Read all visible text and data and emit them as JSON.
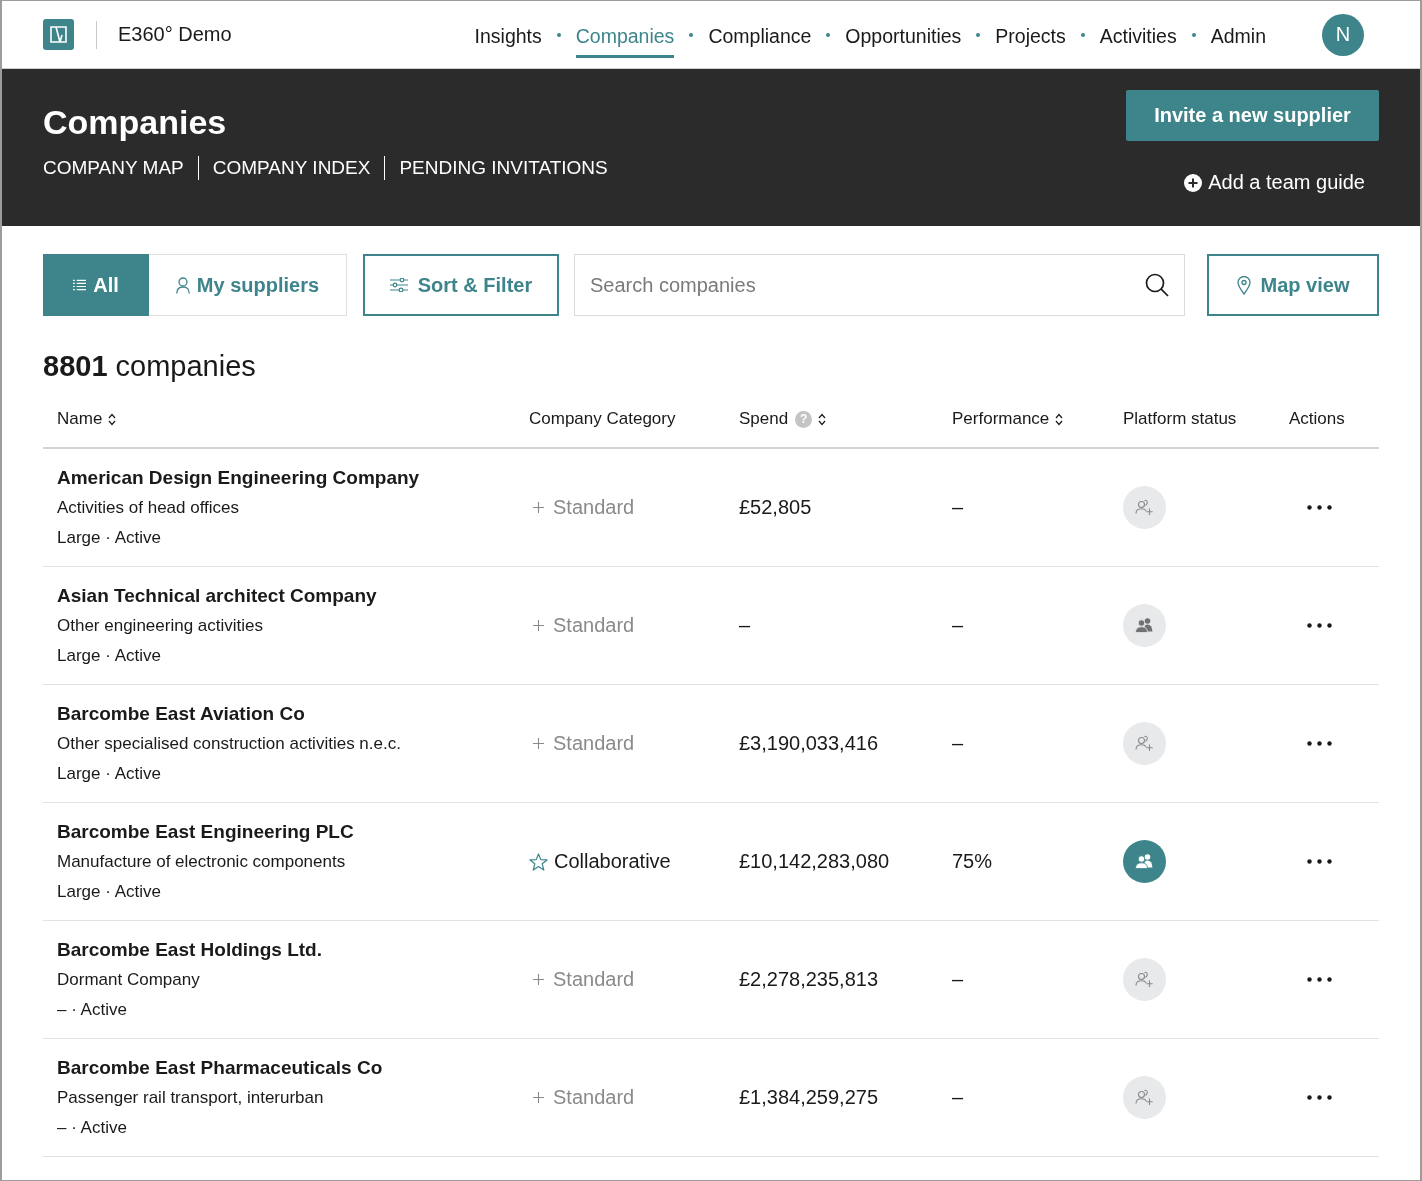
{
  "nav": {
    "app_name": "E360° Demo",
    "links": [
      {
        "label": "Insights",
        "selected": false
      },
      {
        "label": "Companies",
        "selected": true
      },
      {
        "label": "Compliance",
        "selected": false
      },
      {
        "label": "Opportunities",
        "selected": false
      },
      {
        "label": "Projects",
        "selected": false
      },
      {
        "label": "Activities",
        "selected": false
      },
      {
        "label": "Admin",
        "selected": false
      }
    ],
    "avatar_initial": "N"
  },
  "header": {
    "title": "Companies",
    "subnav": [
      "COMPANY MAP",
      "COMPANY INDEX",
      "PENDING INVITATIONS"
    ],
    "invite_button": "Invite a new supplier",
    "team_guide_link": "Add a team guide"
  },
  "toolbar": {
    "views": [
      {
        "label": "All",
        "kind": "list",
        "selected": true
      },
      {
        "label": "My suppliers",
        "kind": "person",
        "selected": false
      }
    ],
    "sort_filter_button": "Sort & Filter",
    "search": {
      "placeholder": "Search companies"
    },
    "map_view_button": "Map view"
  },
  "summary": "**8801** companies",
  "table": {
    "columns": [
      {
        "label": "Name",
        "sortable": true
      },
      {
        "label": "Company Category",
        "sortable": false
      },
      {
        "label": "Spend",
        "sortable": true,
        "help": "?"
      },
      {
        "label": "Performance",
        "sortable": true
      },
      {
        "label": "Platform status",
        "sortable": false
      },
      {
        "label": "Actions",
        "sortable": false
      }
    ],
    "rows": [
      {
        "name": "American Design Engineering Company",
        "activity": "Activities of head offices",
        "details": "Large · Active",
        "category": {
          "kind": "standard",
          "label": "Standard"
        },
        "spend": "£52,805",
        "performance": "–",
        "platform_status": {
          "kind": "invite"
        }
      },
      {
        "name": "Asian Technical architect Company",
        "activity": "Other engineering activities",
        "details": "Large · Active",
        "category": {
          "kind": "standard",
          "label": "Standard"
        },
        "spend": "–",
        "performance": "–",
        "platform_status": {
          "kind": "registered"
        }
      },
      {
        "name": "Barcombe East Aviation Co",
        "activity": "Other specialised construction activities n.e.c.",
        "details": "Large · Active",
        "category": {
          "kind": "standard",
          "label": "Standard"
        },
        "spend": "£3,190,033,416",
        "performance": "–",
        "platform_status": {
          "kind": "invite"
        }
      },
      {
        "name": "Barcombe East Engineering PLC",
        "activity": "Manufacture of electronic components",
        "details": "Large · Active",
        "category": {
          "kind": "collaborative",
          "label": "Collaborative"
        },
        "spend": "£10,142,283,080",
        "performance": "75%",
        "platform_status": {
          "kind": "connected"
        }
      },
      {
        "name": "Barcombe East Holdings Ltd.",
        "activity": "Dormant Company",
        "details": "– · Active",
        "category": {
          "kind": "standard",
          "label": "Standard"
        },
        "spend": "£2,278,235,813",
        "performance": "–",
        "platform_status": {
          "kind": "invite"
        }
      },
      {
        "name": "Barcombe East Pharmaceuticals Co",
        "activity": "Passenger rail transport, interurban",
        "details": "– · Active",
        "category": {
          "kind": "standard",
          "label": "Standard"
        },
        "spend": "£1,384,259,275",
        "performance": "–",
        "platform_status": {
          "kind": "invite"
        }
      }
    ]
  }
}
